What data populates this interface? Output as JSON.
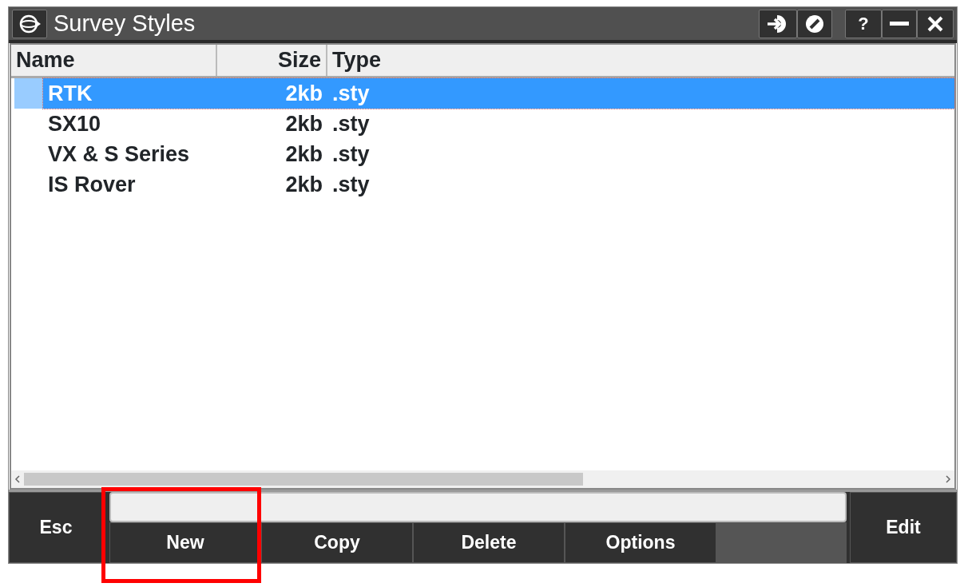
{
  "window": {
    "title": "Survey Styles",
    "help_label": "?"
  },
  "table": {
    "columns": [
      {
        "label": "Name"
      },
      {
        "label": "Size"
      },
      {
        "label": "Type"
      }
    ],
    "rows": [
      {
        "name": "RTK",
        "size": "2kb",
        "type": ".sty",
        "selected": true
      },
      {
        "name": "SX10",
        "size": "2kb",
        "type": ".sty",
        "selected": false
      },
      {
        "name": "VX & S Series",
        "size": "2kb",
        "type": ".sty",
        "selected": false
      },
      {
        "name": "IS Rover",
        "size": "2kb",
        "type": ".sty",
        "selected": false
      }
    ]
  },
  "softkeys": {
    "left": "Esc",
    "right": "Edit",
    "buttons": [
      {
        "label": "New",
        "highlighted": true
      },
      {
        "label": "Copy",
        "highlighted": false
      },
      {
        "label": "Delete",
        "highlighted": false
      },
      {
        "label": "Options",
        "highlighted": false
      }
    ]
  }
}
